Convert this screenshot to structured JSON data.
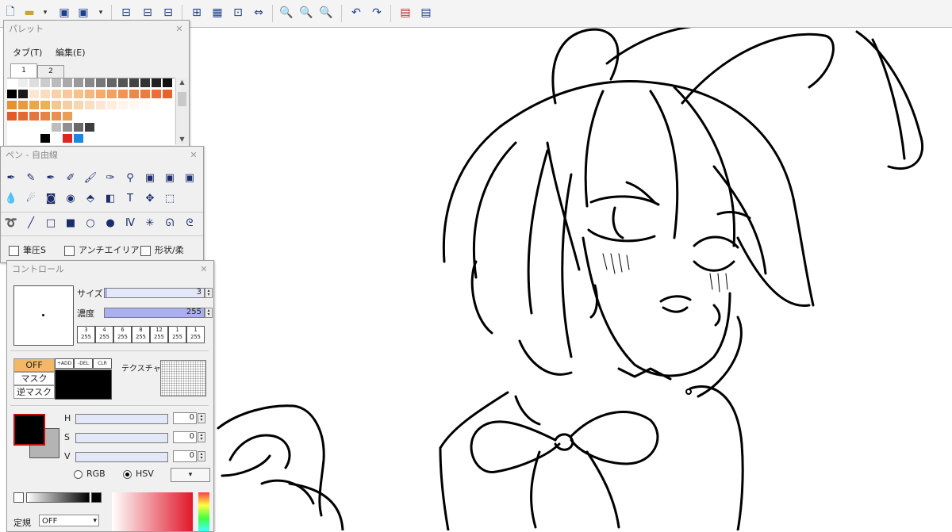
{
  "toolbar": {
    "icons": [
      "new-file-icon",
      "open-file-icon",
      "dropdown-icon",
      "save-icon",
      "save-as-icon",
      "dropdown-icon",
      "window-icon-1",
      "window-icon-2",
      "window-icon-3",
      "crop-icon",
      "transparency-grid-icon",
      "fit-window-icon",
      "stretch-width-icon",
      "zoom-actual-icon",
      "zoom-in-icon",
      "zoom-out-icon",
      "undo-icon",
      "redo-icon",
      "clear-layer-icon",
      "layer-copy-icon"
    ]
  },
  "palette": {
    "title": "パレット",
    "menu_tab": "タブ(T)",
    "menu_edit": "編集(E)",
    "tab1": "1",
    "tab2": "2",
    "rows": [
      [
        "#ffffff",
        "#eeeeee",
        "#dddddd",
        "#cccccc",
        "#bbbbbb",
        "#aaaaaa",
        "#999999",
        "#888888",
        "#777777",
        "#666666",
        "#555555",
        "#444444",
        "#333333",
        "#222222",
        "#111111"
      ],
      [
        "#000000",
        "#1a1a1a",
        "#fbe8d4",
        "#fbdcbc",
        "#fad0a8",
        "#fac89a",
        "#f9c08a",
        "#f8b67a",
        "#f6ab6b",
        "#f4a05e",
        "#f29352",
        "#f08646",
        "#ee7a3c",
        "#ec6e33",
        "#ea622a"
      ],
      [
        "#e8902e",
        "#e99a3a",
        "#eba646",
        "#edb052",
        "#f3c890",
        "#f5cfa0",
        "#f7d7b0",
        "#f9dec0",
        "#fbe6d0",
        "#fdeedf",
        "#fff5ee",
        "#fff8f2",
        "#fffbf7",
        "#ffffff",
        "#ffffff"
      ],
      [
        "#e05a2b",
        "#e26834",
        "#e4753d",
        "#e68346",
        "#e8904f",
        "#ea9d58",
        "#ffffff",
        "#ffffff",
        "#ffffff",
        "#ffffff",
        "#ffffff",
        "#ffffff",
        "#ffffff",
        "#ffffff",
        "#ffffff"
      ],
      [
        "#ffffff",
        "#ffffff",
        "#ffffff",
        "#ffffff",
        "#bdbdbd",
        "#8f8f8f",
        "#686868",
        "#3d3d3d",
        "#ffffff",
        "#ffffff",
        "#ffffff",
        "#ffffff",
        "#ffffff",
        "#ffffff",
        "#ffffff"
      ],
      [
        "#ffffff",
        "#ffffff",
        "#ffffff",
        "#000000",
        "#ffffff",
        "#e02424",
        "#1c86e0",
        "#ffffff",
        "#ffffff",
        "#ffffff",
        "#ffffff",
        "#ffffff",
        "#ffffff",
        "#ffffff",
        "#ffffff"
      ]
    ]
  },
  "pen": {
    "title": "ペン - 自由線",
    "tools_row1": [
      "pen-icon",
      "pencil-icon",
      "fountain-pen-icon",
      "pen-2-icon",
      "brush-icon",
      "airbrush-icon",
      "stamp-icon",
      "layer-icon-a",
      "layer-icon-b",
      "layer-icon-c"
    ],
    "tools_row2": [
      "water-drop-icon",
      "blur-icon",
      "blend-icon",
      "dodge-icon",
      "fill-icon",
      "gradient-icon",
      "text-tool-icon",
      "move-icon",
      "selection-icon"
    ],
    "shapes": [
      "lasso-icon",
      "line-icon",
      "rect-outline-icon",
      "rect-fill-icon",
      "ellipse-outline-icon",
      "ellipse-fill-icon",
      "polyline-icon",
      "burst-icon",
      "curve-icon",
      "curve-2-icon"
    ],
    "opt_pressure": "筆圧S",
    "opt_antialias": "アンチエイリアス",
    "opt_shape": "形状/柔"
  },
  "control": {
    "title": "コントロール",
    "size_label": "サイズ",
    "size_value": "3",
    "density_label": "濃度",
    "density_value": "255",
    "presets": [
      [
        "3",
        "255"
      ],
      [
        "4",
        "255"
      ],
      [
        "6",
        "255"
      ],
      [
        "8",
        "255"
      ],
      [
        "12",
        "255"
      ],
      [
        "1",
        "255"
      ],
      [
        "1",
        "255"
      ]
    ],
    "mask_off": "OFF",
    "mask": "マスク",
    "inverse_mask": "逆マスク",
    "add": "+ADD",
    "del": "-DEL",
    "clr": "CLR",
    "texture_label": "テクスチャ",
    "h_label": "H",
    "s_label": "S",
    "v_label": "V",
    "h_value": "0",
    "s_value": "0",
    "v_value": "0",
    "rgb": "RGB",
    "hsv": "HSV",
    "preset_label": "定規",
    "preset_value": "OFF"
  },
  "colors": {
    "fg": "#000000",
    "bg": "#b4b4b4"
  }
}
